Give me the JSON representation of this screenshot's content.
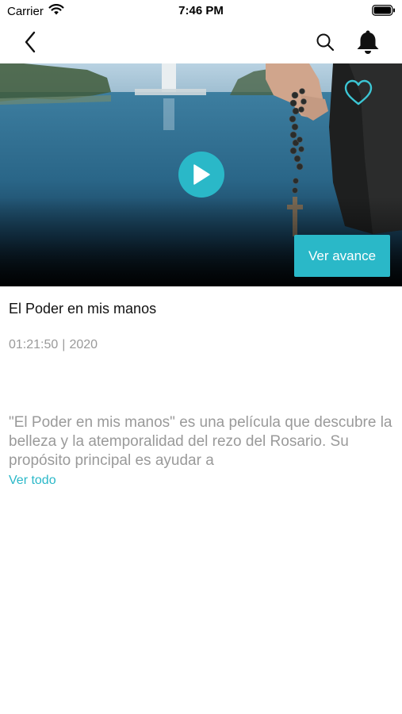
{
  "status_bar": {
    "carrier": "Carrier",
    "time": "7:46 PM"
  },
  "nav": {
    "back_icon": "chevron-left-icon",
    "search_icon": "search-icon",
    "notifications_icon": "bell-icon"
  },
  "hero": {
    "play_icon": "play-icon",
    "favorite_icon": "heart-outline-icon",
    "trailer_label": "Ver avance"
  },
  "movie": {
    "title": "El Poder en mis manos",
    "duration": "01:21:50",
    "separator": "|",
    "year": "2020",
    "description": "\"El Poder en mis manos\" es una película que descubre la belleza y la atemporalidad del rezo del Rosario. Su propósito principal es ayudar a",
    "see_all_label": "Ver todo"
  },
  "colors": {
    "accent": "#2ab8c8",
    "secondary_text": "#9a9a9a",
    "primary_text": "#111111"
  }
}
